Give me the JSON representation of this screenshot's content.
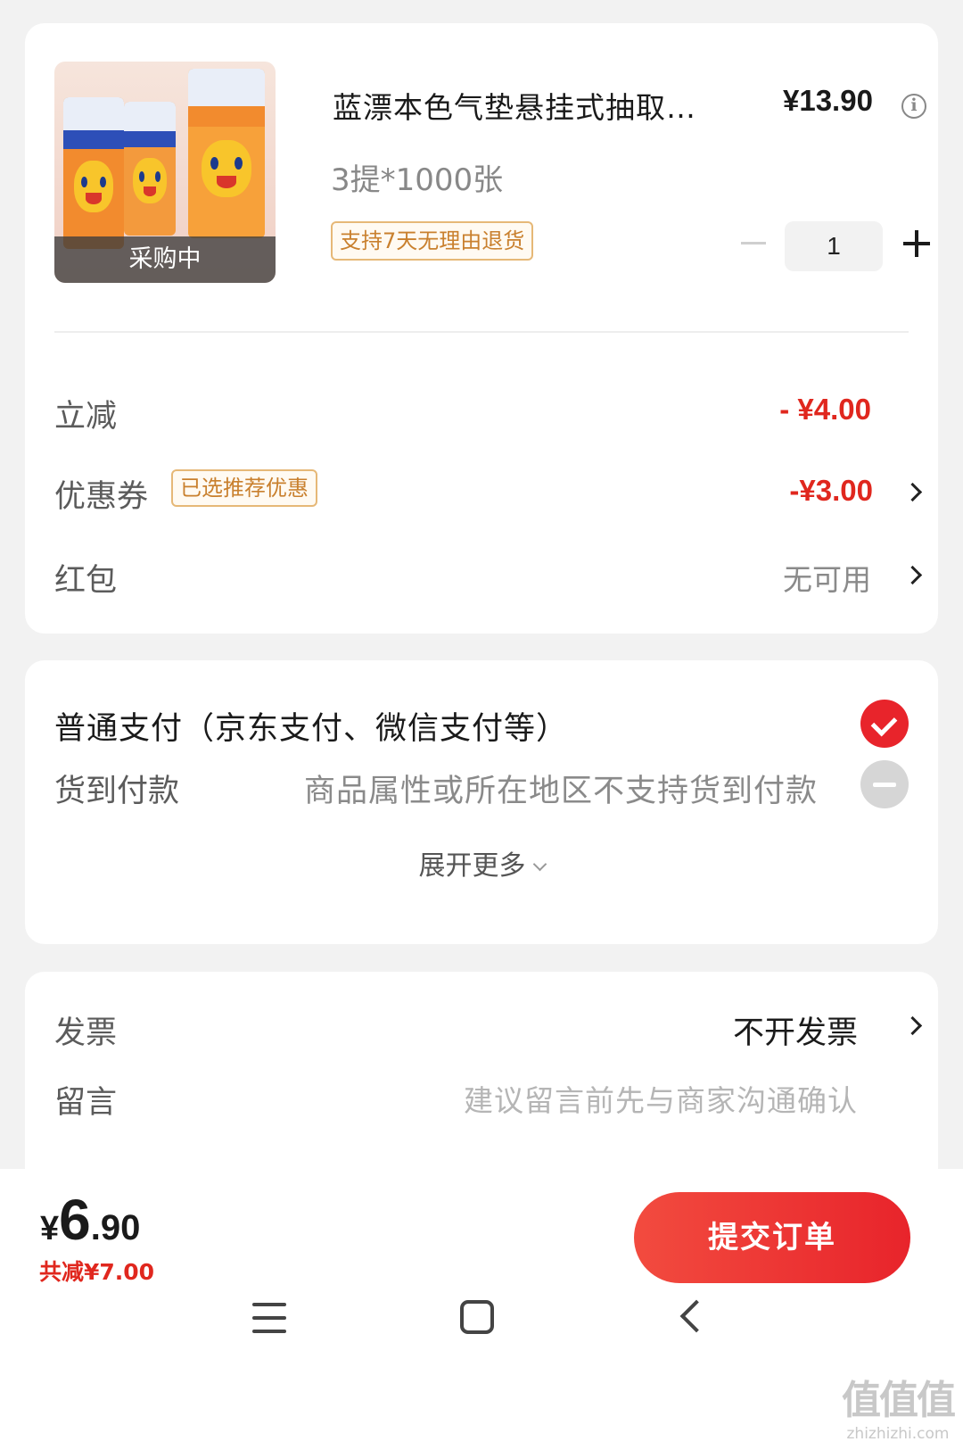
{
  "product": {
    "title": "蓝漂本色气垫悬挂式抽取…",
    "price": "¥13.90",
    "info_icon": "info-icon",
    "spec": "3提*1000张",
    "return_policy": "支持7天无理由退货",
    "badge": "采购中",
    "quantity": "1"
  },
  "discounts": {
    "instant_label": "立减",
    "instant_value": "- ¥4.00",
    "coupon_label": "优惠券",
    "coupon_tag": "已选推荐优惠",
    "coupon_value": "-¥3.00",
    "redpacket_label": "红包",
    "redpacket_value": "无可用"
  },
  "payment": {
    "standard_label": "普通支付（京东支付、微信支付等）",
    "cod_label": "货到付款",
    "cod_note": "商品属性或所在地区不支持货到付款",
    "expand_more": "展开更多"
  },
  "invoice": {
    "invoice_label": "发票",
    "invoice_value": "不开发票",
    "memo_label": "留言",
    "memo_placeholder": "建议留言前先与商家沟通确认"
  },
  "footer": {
    "total_currency": "¥",
    "total_int": "6",
    "total_dec": ".90",
    "total_saved": "共减¥7.00",
    "submit_label": "提交订单"
  },
  "watermark": {
    "logo": "值值值",
    "site": "zhizhizhi.com"
  },
  "colors": {
    "accent_red": "#e8242b",
    "tag_orange": "#c9802e",
    "background": "#f2f2f2"
  }
}
